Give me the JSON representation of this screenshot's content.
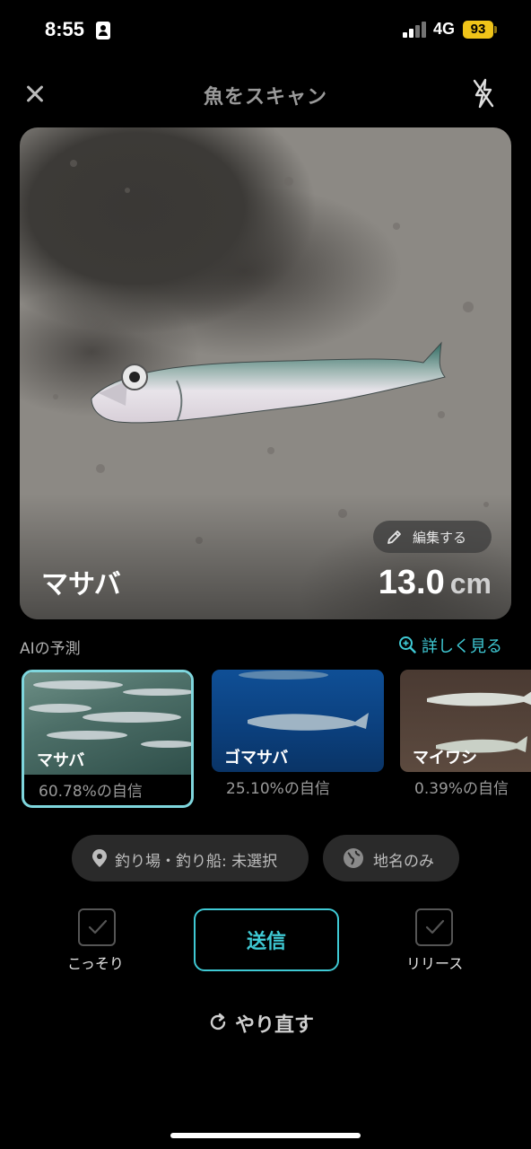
{
  "status_bar": {
    "time": "8:55",
    "network": "4G",
    "battery": "93",
    "battery_color": "#f0c419"
  },
  "header": {
    "title": "魚をスキャン",
    "close_icon": "close-icon",
    "flash_icon": "flash-off-icon"
  },
  "photo": {
    "species": "マサバ",
    "length_value": "13.0",
    "length_unit": "cm",
    "edit_label": "編集する"
  },
  "ai": {
    "section_label": "AIの予測",
    "details_label": "詳しく見る",
    "candidates": [
      {
        "name": "マサバ",
        "confidence": "60.78%の自信",
        "selected": true
      },
      {
        "name": "ゴマサバ",
        "confidence": "25.10%の自信",
        "selected": false
      },
      {
        "name": "マイワシ",
        "confidence": "0.39%の自信",
        "selected": false
      }
    ]
  },
  "location": {
    "spot_label": "釣り場・釣り船: 未選択",
    "place_label": "地名のみ"
  },
  "actions": {
    "secret_label": "こっそり",
    "send_label": "送信",
    "release_label": "リリース",
    "retry_label": "やり直す"
  },
  "colors": {
    "accent": "#3fc9d4",
    "selected_border": "#7fd6dd",
    "pill_bg": "#2a2a2a",
    "background": "#000000"
  }
}
